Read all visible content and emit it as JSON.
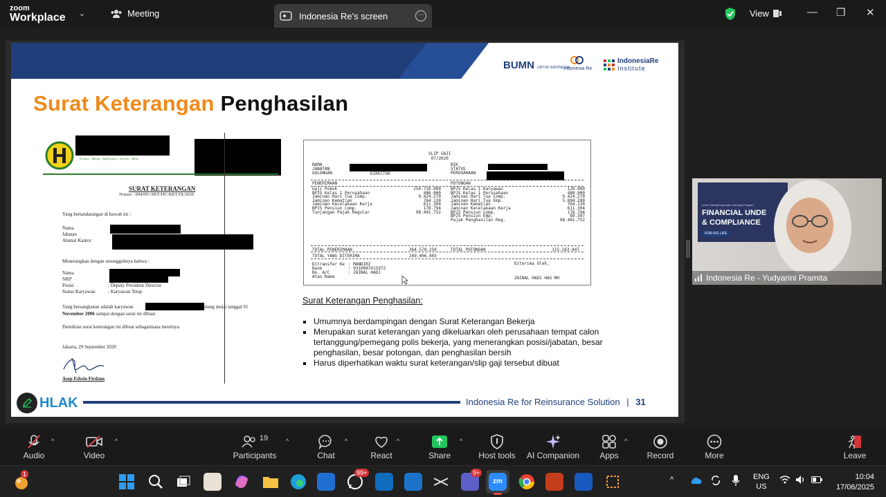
{
  "app": {
    "brand_top": "zoom",
    "brand_bottom": "Workplace"
  },
  "tabs": {
    "meeting": "Meeting",
    "screen_share": "Indonesia Re's screen"
  },
  "top_right": {
    "view_label": "View"
  },
  "slide": {
    "title_orange": "Surat Keterangan",
    "title_dark": "Penghasilan",
    "logos": {
      "bumn": "BUMN",
      "bumn_sub": "UNTUK INDONESIA",
      "indonesia_re": "Indonesia Re",
      "institute_top": "IndonesiaRe",
      "institute_bottom": "Institute"
    },
    "letter": {
      "header_tagline": "Forestry – Mining – Agribusiness – Services – Media",
      "heading": "SURAT KETERANGAN",
      "number": "Nomor : 094/HG-SKT/HC-KET/IX/2020",
      "intro": "Yang bertandatangan di bawah ini :",
      "fields1": [
        "Nama",
        "Jabatan",
        "Alamat Kantor"
      ],
      "explain": "Menerangkan dengan sesungguhnya bahwa :",
      "fields2": [
        "Nama",
        "NRP",
        "Posisi",
        "Status Karyawan"
      ],
      "posisi": ": Deputy President Director",
      "status": ": Karyawan Tetap",
      "line1a": "Yang bersangkutan adalah karyawan",
      "line1b": "terhitung mulai tanggal  01",
      "line2a": "November 2006",
      "line2b": "sampai dengan surat ini dibuat.",
      "closing": "Demikian surat keterangan ini dibuat sebagaimana mestinya.",
      "date": "Jakarta, 29 September 2020",
      "signer": "Asep Edwin Firdaus"
    },
    "payslip": {
      "title": "SLIP GAJI",
      "period": "07/2020",
      "left_labels": [
        "NAMA",
        "JABATAN",
        "GOLONGAN"
      ],
      "jabatan_value": "DIRECTOR",
      "right_labels": [
        "NIK",
        "STATUS",
        "PERUSAHAAN"
      ],
      "penerimaan_header": "PENERIMAAN",
      "potongan_header": "POTONGAN",
      "penerimaan": [
        [
          "Gaji Pokok",
          "254.710.000"
        ],
        [
          "BPJS Kelas 1 Perusahaan",
          "480.000"
        ],
        [
          "Jaminan Hari Tua Comp.",
          "9.424.270"
        ],
        [
          "Jaminan Kematian",
          "764.130"
        ],
        [
          "Jaminan Kecelakaan Kerja",
          "611.304"
        ],
        [
          "BPJS Pensiun Comp.",
          "178.794"
        ],
        [
          "Tunjangan Pajak Regular",
          "98.401.752"
        ]
      ],
      "potongan": [
        [
          "BPJS Kelas 1 Karyawan",
          "120.000"
        ],
        [
          "BPJS Kelas 1 Perusahaan",
          "480.000"
        ],
        [
          "Jaminan Hari Tua Comp.",
          "9.424.270"
        ],
        [
          "Jaminan Hari Tua Emp.",
          "5.094.200"
        ],
        [
          "Jaminan Kematian",
          "764.130"
        ],
        [
          "Jaminan Kecelakaan Kerja",
          "611.304"
        ],
        [
          "BPJS Pensiun Comp.",
          "178.794"
        ],
        [
          "BPJS Pensiun Emp.",
          "89.397"
        ],
        [
          "Pajak Penghasilan Reg.",
          "98.401.752"
        ]
      ],
      "total_penerimaan_label": "TOTAL PENERIMAAN",
      "total_penerimaan": "364.570.250",
      "total_potongan_label": "TOTAL POTONGAN",
      "total_potongan": "115.163.847",
      "total_diterima_label": "TOTAL YANG DITERIMA",
      "total_diterima": "249.406.403",
      "transfer_labels": [
        "Ditransfer Ke",
        "Bank",
        "No. A/C",
        "Atas Nama"
      ],
      "transfer_values": [
        "",
        ": MANDIRI",
        ": 0310007415972",
        ": ZAINAL HADI"
      ],
      "received_label": "Diterima Oleh,",
      "received_name": "ZAINAL HADI HAS MH"
    },
    "notes": {
      "heading": "Surat Keterangan Penghasilan:",
      "bullets": [
        "Umumnya berdampingan dengan Surat Keterangan Bekerja",
        "Merupakan surat keterangan yang dikeluarkan oleh perusahaan tempat calon tertanggung/pemegang polis bekerja, yang menerangkan posisi/jabatan, besar penghasilan, besar potongan, dan penghasilan bersih",
        "Harus diperhatikan waktu surat keterangan/slip gaji tersebut dibuat"
      ]
    },
    "footer": {
      "akhlak": "AKHLAK",
      "akhlak_shown": "HLAK",
      "text": "Indonesia Re for Reinsurance Solution",
      "sep": "|",
      "page": "31"
    }
  },
  "video": {
    "name": "Indonesia Re - Yudyarini Pramita",
    "banner_lines": [
      "Lean Coding/Corporate Learning Program",
      "FINANCIAL UNDE",
      "& COMPLIANCE",
      "FOR IFG LIFE"
    ]
  },
  "toolbar": {
    "items": [
      "Audio",
      "Video",
      "Participants",
      "Chat",
      "React",
      "Share",
      "Host tools",
      "AI Companion",
      "Apps",
      "Record",
      "More"
    ],
    "participants_count": "19",
    "leave": "Leave"
  },
  "taskbar": {
    "notification_badge": "1",
    "whatsapp_badge": "99+",
    "teams_badge": "9+",
    "lang_top": "ENG",
    "lang_bottom": "US",
    "time": "10:04",
    "date": "17/06/2025"
  },
  "colors": {
    "accent_orange": "#ef8a1a",
    "navy": "#1f3e7a",
    "zoom_green": "#22c55e",
    "record_red": "#d13438"
  }
}
